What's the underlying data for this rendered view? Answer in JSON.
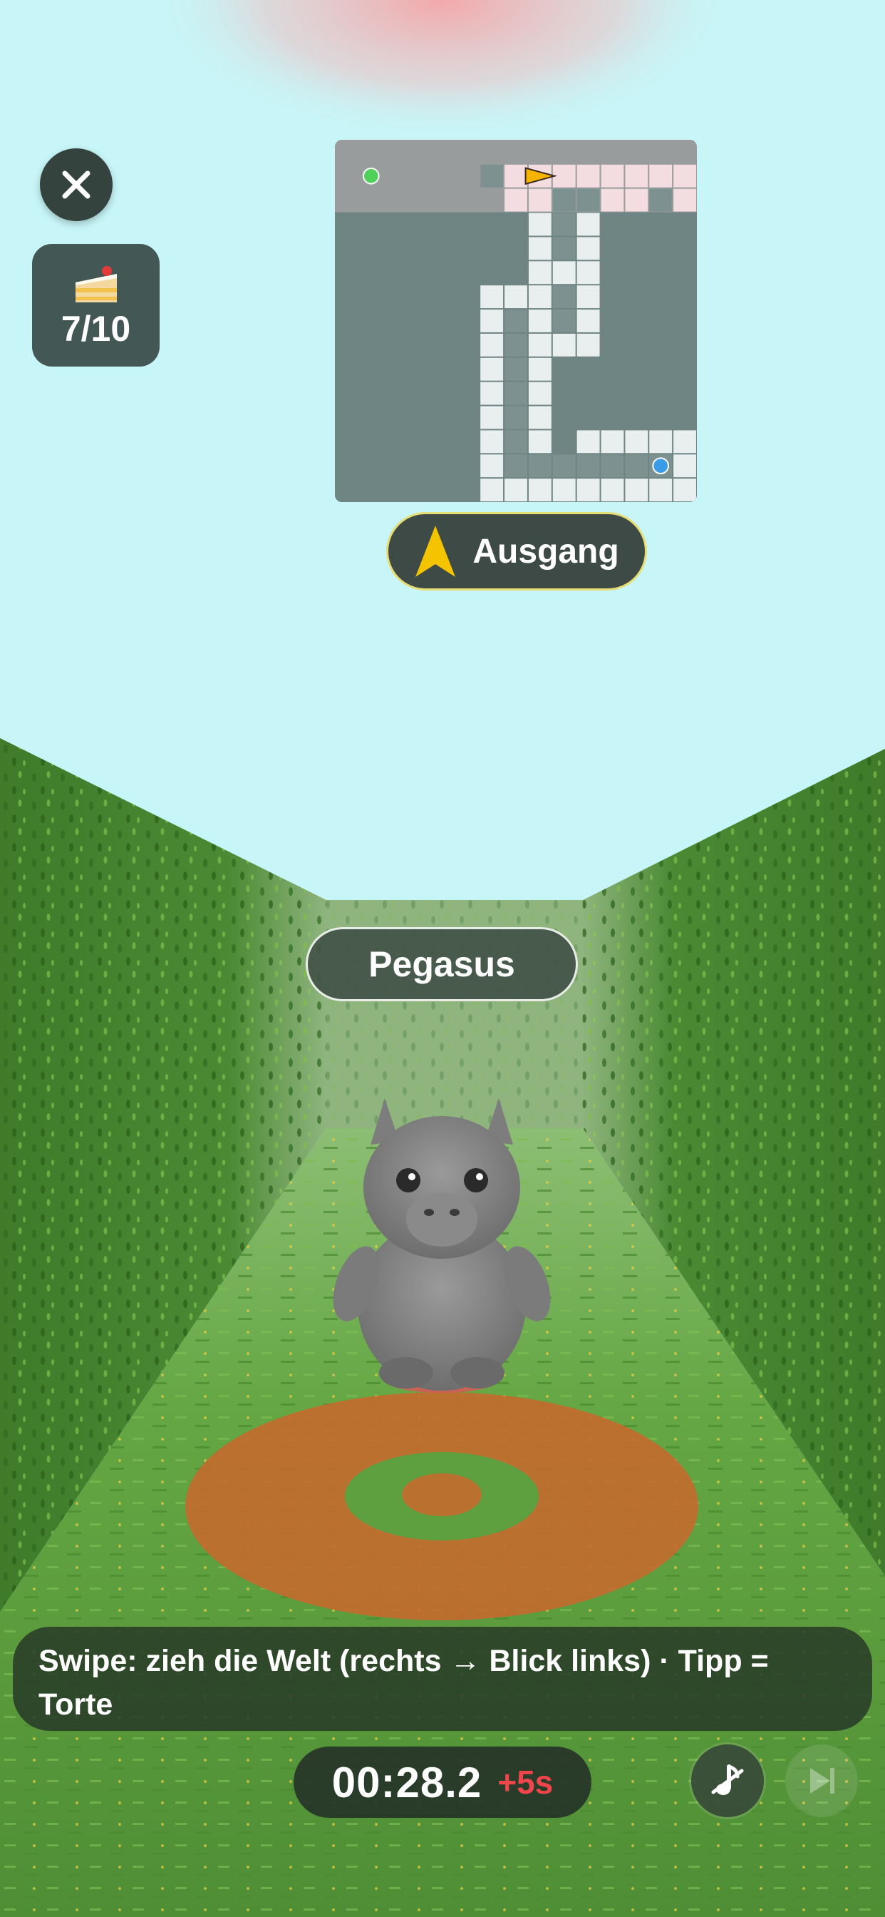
{
  "colors": {
    "sky": "#c8f6f8",
    "hedge": "#4e8a32",
    "path": "#5ea040",
    "target_ring": "#c46a2e",
    "accent_yellow": "#f5c400",
    "penalty_red": "#f0454b"
  },
  "hud": {
    "cake_count": "7/10",
    "compass_label": "Ausgang",
    "character_name": "Pegasus",
    "hint": "Swipe: zieh die Welt (rechts → Blick links) · Tipp = Torte",
    "timer": "00:28.2",
    "penalty": "+5s"
  },
  "icons": {
    "close": "close-icon",
    "cake": "cake-icon",
    "compass": "compass-arrow-icon",
    "sound": "sound-off-icon",
    "skip": "skip-forward-icon"
  },
  "minimap": {
    "cols": 15,
    "rows": 15,
    "visited_cells": [
      [
        7,
        1
      ],
      [
        8,
        1
      ],
      [
        9,
        1
      ],
      [
        10,
        1
      ],
      [
        11,
        1
      ],
      [
        12,
        1
      ],
      [
        13,
        1
      ],
      [
        14,
        1
      ],
      [
        14,
        2
      ],
      [
        7,
        2
      ],
      [
        8,
        2
      ],
      [
        11,
        2
      ],
      [
        12,
        2
      ],
      [
        8,
        3
      ],
      [
        10,
        3
      ],
      [
        8,
        4
      ],
      [
        10,
        4
      ],
      [
        8,
        5
      ],
      [
        9,
        5
      ],
      [
        10,
        5
      ],
      [
        6,
        6
      ],
      [
        7,
        6
      ],
      [
        8,
        6
      ],
      [
        10,
        6
      ],
      [
        6,
        7
      ],
      [
        8,
        7
      ],
      [
        10,
        7
      ],
      [
        6,
        8
      ],
      [
        8,
        8
      ],
      [
        9,
        8
      ],
      [
        10,
        8
      ],
      [
        6,
        9
      ],
      [
        8,
        9
      ],
      [
        6,
        10
      ],
      [
        8,
        10
      ],
      [
        6,
        11
      ],
      [
        8,
        11
      ],
      [
        6,
        12
      ],
      [
        8,
        12
      ],
      [
        10,
        12
      ],
      [
        11,
        12
      ],
      [
        12,
        12
      ],
      [
        13,
        12
      ],
      [
        14,
        12
      ],
      [
        6,
        13
      ],
      [
        14,
        13
      ],
      [
        6,
        14
      ],
      [
        7,
        14
      ],
      [
        8,
        14
      ],
      [
        9,
        14
      ],
      [
        10,
        14
      ],
      [
        11,
        14
      ],
      [
        12,
        14
      ],
      [
        13,
        14
      ],
      [
        14,
        14
      ]
    ],
    "path_cells": [
      [
        6,
        1
      ],
      [
        9,
        2
      ],
      [
        10,
        2
      ],
      [
        13,
        2
      ],
      [
        9,
        3
      ],
      [
        9,
        4
      ],
      [
        9,
        6
      ],
      [
        9,
        7
      ],
      [
        7,
        7
      ],
      [
        7,
        8
      ],
      [
        7,
        9
      ],
      [
        7,
        10
      ],
      [
        7,
        11
      ],
      [
        7,
        12
      ],
      [
        7,
        13
      ],
      [
        8,
        13
      ],
      [
        9,
        13
      ],
      [
        10,
        13
      ],
      [
        11,
        13
      ],
      [
        12,
        13
      ],
      [
        13,
        13
      ]
    ],
    "player": {
      "col": 8.5,
      "row": 1.5,
      "heading": "east"
    },
    "start_marker": {
      "col": 1.5,
      "row": 1.5
    },
    "exit_marker": {
      "col": 13.5,
      "row": 13.5
    }
  }
}
